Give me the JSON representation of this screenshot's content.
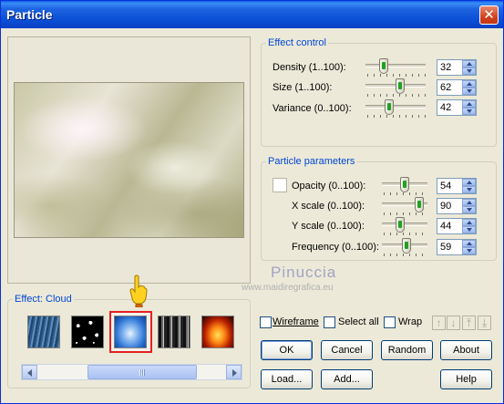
{
  "window": {
    "title": "Particle"
  },
  "effect_control": {
    "legend": "Effect control",
    "rows": [
      {
        "label": "Density (1..100):",
        "value": "32",
        "level": 32
      },
      {
        "label": "Size (1..100):",
        "value": "62",
        "level": 62
      },
      {
        "label": "Variance (0..100):",
        "value": "42",
        "level": 42
      }
    ]
  },
  "particle_parameters": {
    "legend": "Particle parameters",
    "rows": [
      {
        "label": "Opacity (0..100):",
        "value": "54",
        "level": 54
      },
      {
        "label": "X scale (0..100):",
        "value": "90",
        "level": 90
      },
      {
        "label": "Y scale (0..100):",
        "value": "44",
        "level": 44
      },
      {
        "label": "Frequency (0..100):",
        "value": "59",
        "level": 59
      }
    ]
  },
  "watermark": {
    "line1": "Pinuccia",
    "line2": "www.maidiregrafica.eu"
  },
  "effect_panel": {
    "legend": "Effect: Cloud",
    "selected_index": 2
  },
  "options": {
    "wireframe": "Wireframe",
    "select_all": "Select all",
    "wrap": "Wrap"
  },
  "buttons": {
    "ok": "OK",
    "cancel": "Cancel",
    "random": "Random",
    "about": "About",
    "load": "Load...",
    "add": "Add...",
    "help": "Help"
  },
  "colors": {
    "accent": "#0046d5",
    "selection": "#e52020",
    "titlebar": "#0a4fd6"
  }
}
